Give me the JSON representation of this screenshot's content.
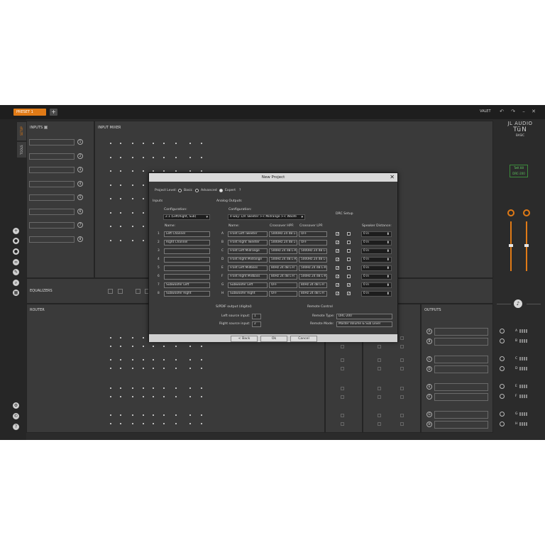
{
  "topbar": {
    "preset_label": "PRESET 1",
    "add_label": "+",
    "valet_label": "VALET"
  },
  "brand": {
    "line1": "JL AUDIO",
    "line2": "TüN",
    "line3": "BASIC",
    "device_line1": "TwK 88",
    "device_line2": "DRC-200"
  },
  "side_tabs": {
    "setup": "SETUP",
    "tools": "TOOLS"
  },
  "panels": {
    "inputs_title": "INPUTS",
    "input_mixer_title": "INPUT MIXER",
    "equalizers_title": "EQUALIZERS",
    "router_title": "ROUTER",
    "outputs_title": "OUTPUTS"
  },
  "input_numbers": [
    "1",
    "2",
    "3",
    "4",
    "5",
    "6",
    "7",
    "8"
  ],
  "output_letters": [
    "A",
    "B",
    "C",
    "D",
    "E",
    "F",
    "G",
    "H"
  ],
  "dialog": {
    "title": "New Project",
    "close": "✕",
    "project_level_label": "Project Level:",
    "levels": [
      "Basic",
      "Advanced",
      "Expert"
    ],
    "selected_level": "Expert",
    "help": "?",
    "inputs_label": "Inputs",
    "inputs_config_label": "Configuration:",
    "inputs_config_value": "2.1 (Left/Right, Sub)",
    "inputs_name_header": "Name:",
    "input_rows": [
      {
        "num": "1",
        "name": "Left Channel"
      },
      {
        "num": "2",
        "name": "Right Channel"
      },
      {
        "num": "3",
        "name": ""
      },
      {
        "num": "4",
        "name": ""
      },
      {
        "num": "5",
        "name": ""
      },
      {
        "num": "6",
        "name": ""
      },
      {
        "num": "7",
        "name": "Subwoofer Left"
      },
      {
        "num": "8",
        "name": "Subwoofer Right"
      }
    ],
    "outputs_label": "Analog Outputs",
    "outputs_config_label": "Configuration:",
    "outputs_config_value": "4-way: L/R Tweeter >< Midrange >< Woofe",
    "drc_setup_label": "DRC Setup",
    "col_name": "Name:",
    "col_hpf": "Crossover HPF:",
    "col_lpf": "Crossover LPF:",
    "col_distance": "Speaker Distance:",
    "output_rows": [
      {
        "letter": "A",
        "name": "Front Left Tweeter",
        "hpf": "5000Hz 24 dB L-R",
        "lpf": "OFF",
        "chk1": true,
        "chk2": false,
        "distance": "0 in"
      },
      {
        "letter": "B",
        "name": "Front Right Tweeter",
        "hpf": "5000Hz 24 dB L-R",
        "lpf": "OFF",
        "chk1": true,
        "chk2": false,
        "distance": "0 in"
      },
      {
        "letter": "C",
        "name": "Front Left Midrange",
        "hpf": "500Hz 24 dB L-R",
        "lpf": "5000Hz 24 dB L-R",
        "chk1": true,
        "chk2": false,
        "distance": "0 in"
      },
      {
        "letter": "D",
        "name": "Front Right Midrange",
        "hpf": "500Hz 24 dB L-R",
        "lpf": "5000Hz 24 dB L-R",
        "chk1": true,
        "chk2": false,
        "distance": "0 in"
      },
      {
        "letter": "E",
        "name": "Front Left Midbass",
        "hpf": "80Hz 24 dB L-R",
        "lpf": "500Hz 24 dB L-R",
        "chk1": true,
        "chk2": false,
        "distance": "0 in"
      },
      {
        "letter": "F",
        "name": "Front Right Midbass",
        "hpf": "80Hz 24 dB L-R",
        "lpf": "500Hz 24 dB L-R",
        "chk1": true,
        "chk2": false,
        "distance": "0 in"
      },
      {
        "letter": "G",
        "name": "Subwoofer Left",
        "hpf": "OFF",
        "lpf": "80Hz 24 dB L-R",
        "chk1": true,
        "chk2": true,
        "distance": "0 in"
      },
      {
        "letter": "H",
        "name": "Subwoofer Right",
        "hpf": "OFF",
        "lpf": "80Hz 24 dB L-R",
        "chk1": true,
        "chk2": true,
        "distance": "0 in"
      }
    ],
    "spdif_label": "S/PDIF output (digital)",
    "left_source_label": "Left source input:",
    "left_source_value": "1",
    "right_source_label": "Right source input:",
    "right_source_value": "2",
    "remote_label": "Remote Control",
    "remote_type_label": "Remote Type:",
    "remote_type_value": "DRC-200",
    "remote_mode_label": "Remote Mode:",
    "remote_mode_value": "Master Volume & Sub Level",
    "back_button": "< Back",
    "ok_button": "Ok",
    "cancel_button": "Cancel"
  }
}
